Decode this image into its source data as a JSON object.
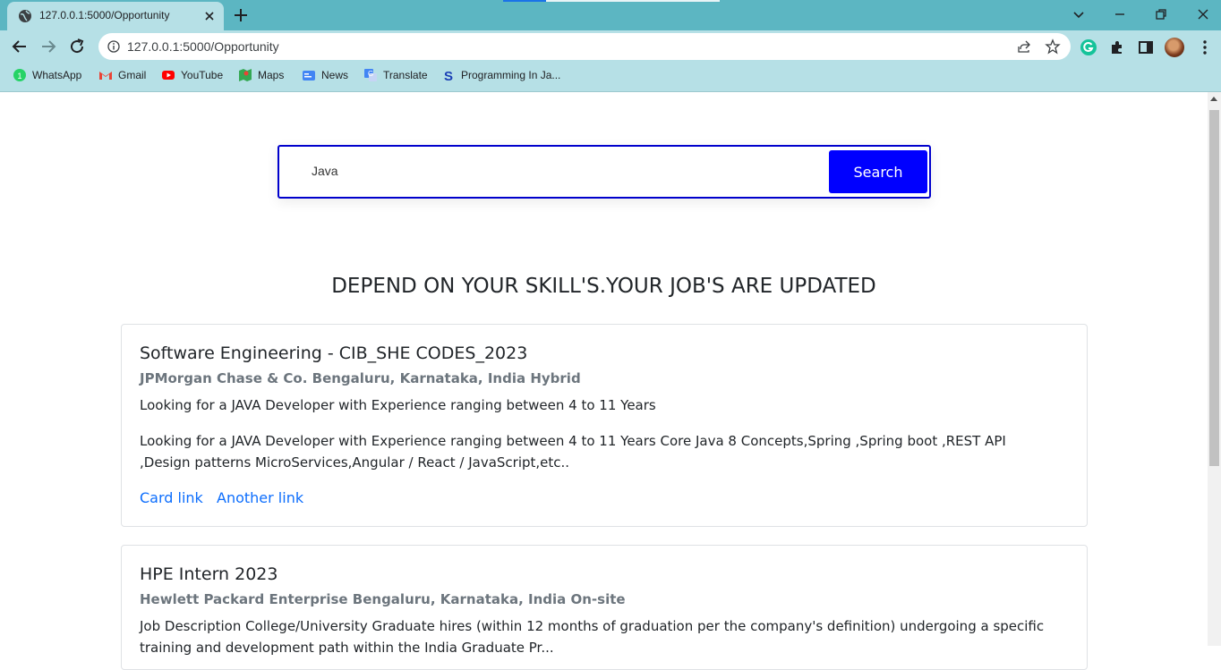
{
  "browser": {
    "tab_title": "127.0.0.1:5000/Opportunity",
    "url": "127.0.0.1:5000/Opportunity",
    "bookmarks": [
      {
        "label": "WhatsApp",
        "icon": "whatsapp-icon"
      },
      {
        "label": "Gmail",
        "icon": "gmail-icon"
      },
      {
        "label": "YouTube",
        "icon": "youtube-icon"
      },
      {
        "label": "Maps",
        "icon": "maps-icon"
      },
      {
        "label": "News",
        "icon": "news-icon"
      },
      {
        "label": "Translate",
        "icon": "translate-icon"
      },
      {
        "label": "Programming In Ja...",
        "icon": "s-logo-icon"
      }
    ]
  },
  "search": {
    "value": "Java",
    "button_label": "Search"
  },
  "page": {
    "heading": "DEPEND ON YOUR SKILL'S.YOUR JOB'S ARE UPDATED"
  },
  "jobs": [
    {
      "title": "Software Engineering - CIB_SHE CODES_2023",
      "subtitle": "JPMorgan Chase & Co. Bengaluru, Karnataka, India Hybrid",
      "summary": "Looking for a JAVA Developer with Experience ranging between 4 to 11 Years",
      "description": "Looking for a JAVA Developer with Experience ranging between 4 to 11 Years Core Java 8 Concepts,Spring ,Spring boot ,REST API ,Design patterns MicroServices,Angular / React / JavaScript,etc..",
      "link1": "Card link",
      "link2": "Another link"
    },
    {
      "title": "HPE Intern 2023",
      "subtitle": "Hewlett Packard Enterprise Bengaluru, Karnataka, India On-site",
      "summary": "Job Description College/University Graduate hires (within 12 months of graduation per the company's definition) undergoing a specific training and development path within the India Graduate Pr..."
    }
  ],
  "colors": {
    "accent": "#0000ff",
    "tabstrip": "#5cb6c2",
    "toolbar": "#b6e0e6",
    "link": "#0d6efd"
  }
}
